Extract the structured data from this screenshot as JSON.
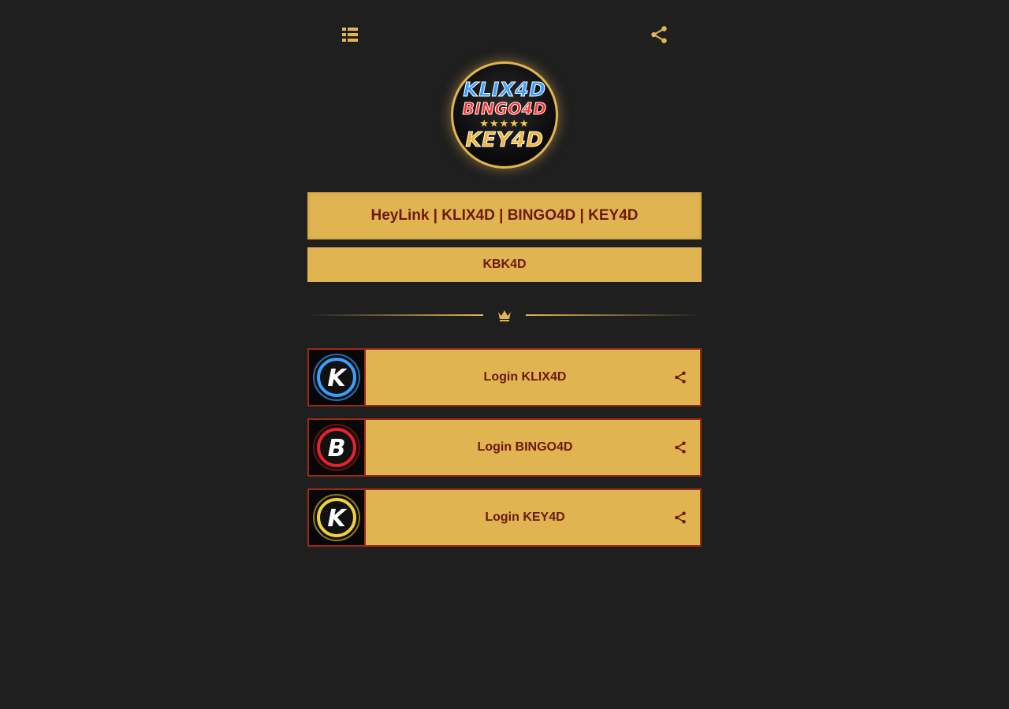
{
  "header": {
    "menu_icon": "list-icon",
    "share_icon": "share-icon"
  },
  "logo": {
    "line1": "KLIX4D",
    "line2": "BINGO4D",
    "line3": "KEY4D",
    "stars": "★★★★★"
  },
  "title": "HeyLink | KLIX4D | BINGO4D | KEY4D",
  "subtitle": "KBK4D",
  "divider": {
    "icon": "crown-icon"
  },
  "links": [
    {
      "label": "Login KLIX4D",
      "letter": "K",
      "ring_color": "#3aa0ff",
      "icon": "share-icon"
    },
    {
      "label": "Login BINGO4D",
      "letter": "B",
      "ring_color": "#e8222a",
      "icon": "share-icon"
    },
    {
      "label": "Login KEY4D",
      "letter": "K",
      "ring_color": "#f2d13a",
      "icon": "share-icon"
    }
  ],
  "colors": {
    "background": "#1f1f1f",
    "gold": "#e1b452",
    "text": "#6b1a10",
    "border": "#9c2a12"
  }
}
